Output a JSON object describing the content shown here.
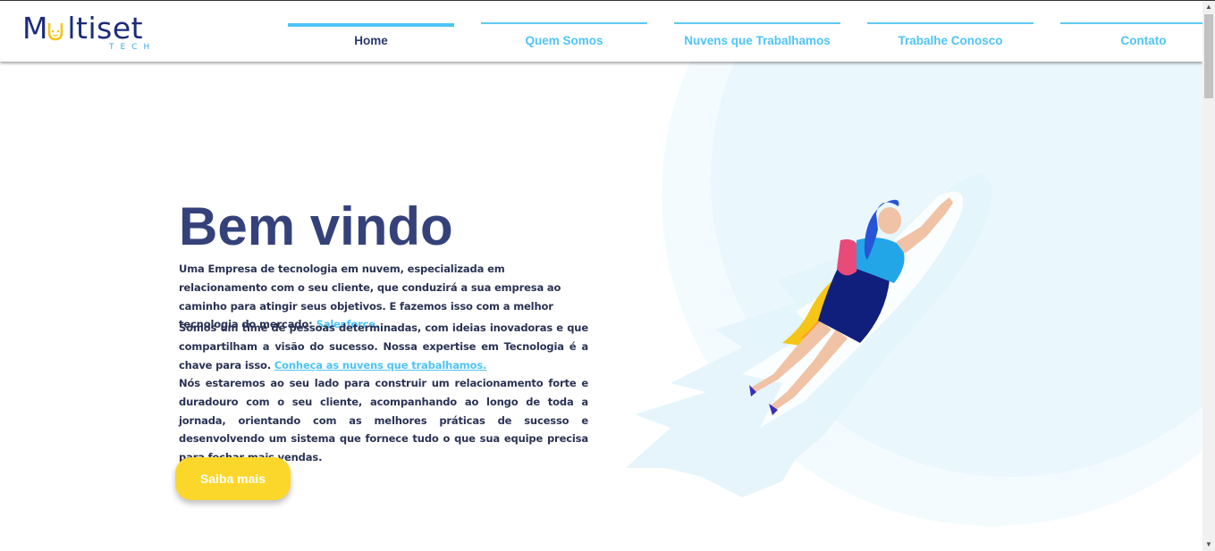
{
  "brand": {
    "name": "Multiset",
    "tagline": "TECH",
    "color": "#1c2c7a",
    "accent": "#3aa9e8"
  },
  "nav": {
    "items": [
      {
        "label": "Home",
        "active": true
      },
      {
        "label": "Quem Somos",
        "active": false
      },
      {
        "label": "Nuvens que Trabalhamos",
        "active": false
      },
      {
        "label": "Trabalhe Conosco",
        "active": false
      },
      {
        "label": "Contato",
        "active": false
      }
    ]
  },
  "hero": {
    "title": "Bem vindo",
    "p1_text": "Uma Empresa de tecnologia em nuvem, especializada em relacionamento com o seu cliente, que conduzirá a sua empresa ao caminho para atingir seus objetivos. E fazemos isso com a melhor tecnologia do mercado:",
    "p1_link": "Salesforce.",
    "p2_text": "Somos um time de pessoas determinadas, com ideias inovadoras e que compartilham a visão do sucesso. Nossa expertise em Tecnologia é a chave para isso.",
    "p2_link": "Conheça as nuvens que trabalhamos.",
    "p3_text": "Nós estaremos ao seu lado para construir um relacionamento forte e duradouro com o seu cliente, acompanhando ao longo de toda a jornada, orientando com as melhores práticas de sucesso e desenvolvendo um sistema que fornece tudo o que sua equipe precisa para fechar mais vendas.",
    "cta_label": "Saiba mais",
    "illustration": "flying-woman-illustration"
  },
  "colors": {
    "title": "#35427a",
    "link": "#4fc3f7",
    "cta": "#fcd72b",
    "nav_active_text": "#2a3b6e"
  }
}
